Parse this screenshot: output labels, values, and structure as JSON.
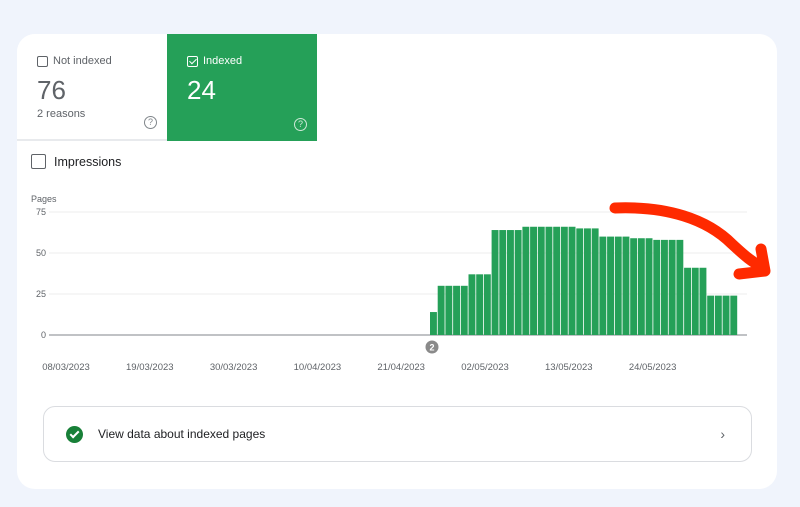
{
  "tiles": {
    "not_indexed": {
      "label": "Not indexed",
      "value": "76",
      "sub": "2 reasons",
      "help": "?"
    },
    "indexed": {
      "label": "Indexed",
      "value": "24",
      "help": "?",
      "checked": true
    }
  },
  "impressions": {
    "label": "Impressions",
    "checked": false
  },
  "link": {
    "label": "View data about indexed pages",
    "chevron": "›"
  },
  "colors": {
    "bar": "#25a058",
    "annotation_arrow": "#ff2a00"
  },
  "chart_data": {
    "type": "bar",
    "title": "",
    "ylabel": "Pages",
    "xlabel": "",
    "ylim": [
      0,
      75
    ],
    "yticks": [
      0,
      25,
      50,
      75
    ],
    "xtick_labels": [
      "08/03/2023",
      "19/03/2023",
      "30/03/2023",
      "10/04/2023",
      "21/04/2023",
      "02/05/2023",
      "13/05/2023",
      "24/05/2023"
    ],
    "start_date": "08/03/2023",
    "total_days": 91,
    "first_bar_day_index": 51,
    "values": [
      14,
      30,
      30,
      30,
      30,
      37,
      37,
      37,
      64,
      64,
      64,
      64,
      66,
      66,
      66,
      66,
      66,
      66,
      66,
      65,
      65,
      65,
      60,
      60,
      60,
      60,
      59,
      59,
      59,
      58,
      58,
      58,
      58,
      41,
      41,
      41,
      24,
      24,
      24,
      24
    ],
    "annotations": [
      {
        "type": "marker",
        "text": "2",
        "day_index": 51
      },
      {
        "type": "arrow",
        "description": "downward trend arrow"
      }
    ],
    "grid": true
  }
}
